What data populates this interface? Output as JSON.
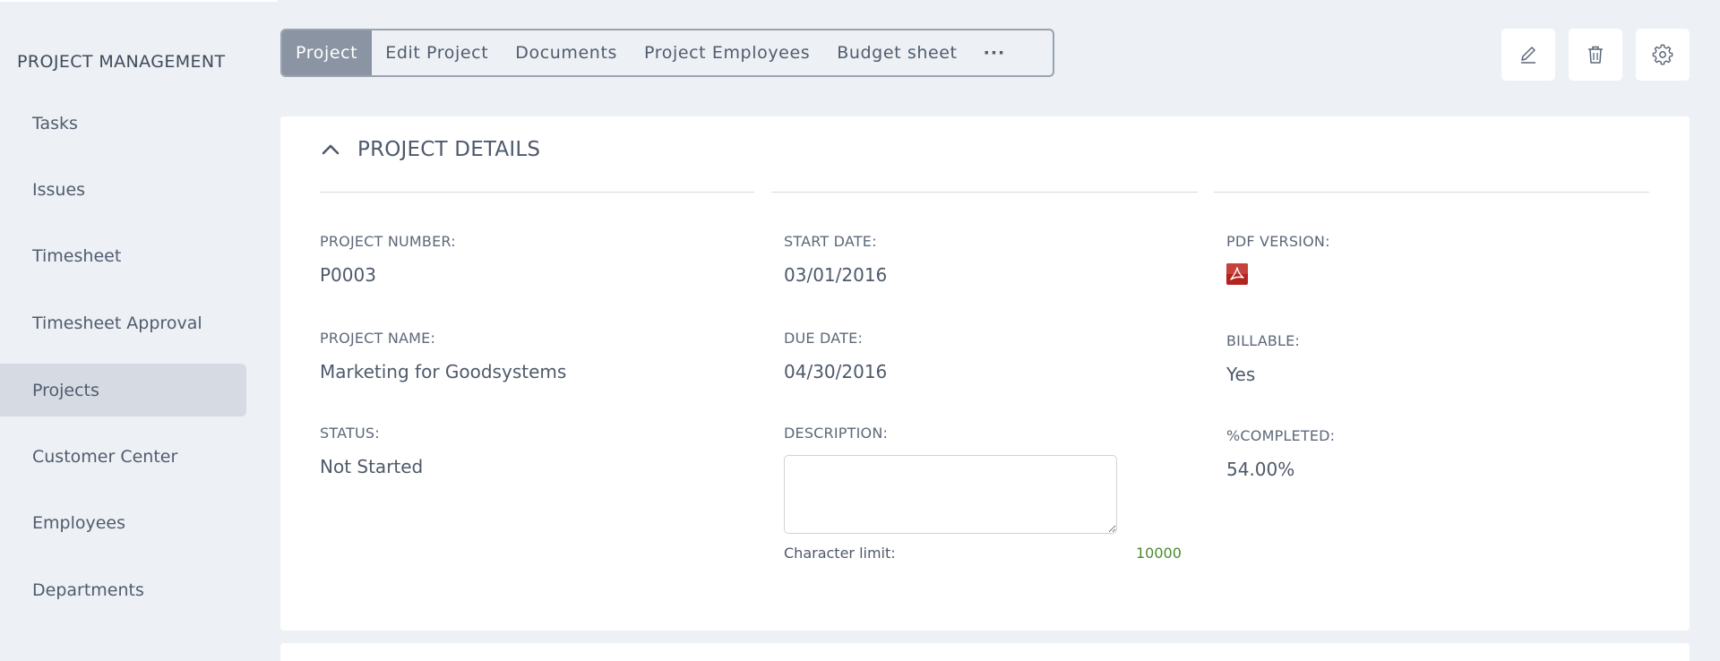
{
  "sidebar": {
    "title": "PROJECT MANAGEMENT",
    "items": [
      {
        "label": "Tasks"
      },
      {
        "label": "Issues"
      },
      {
        "label": "Timesheet"
      },
      {
        "label": "Timesheet Approval"
      },
      {
        "label": "Projects",
        "active": true
      },
      {
        "label": "Customer Center"
      },
      {
        "label": "Employees"
      },
      {
        "label": "Departments"
      }
    ]
  },
  "tabs": {
    "items": [
      {
        "label": "Project",
        "active": true
      },
      {
        "label": "Edit Project"
      },
      {
        "label": "Documents"
      },
      {
        "label": "Project Employees"
      },
      {
        "label": "Budget sheet"
      },
      {
        "label": "···"
      }
    ]
  },
  "actions": {
    "edit_icon": "pencil-icon",
    "delete_icon": "trash-icon",
    "settings_icon": "gear-icon"
  },
  "details": {
    "section_title": "PROJECT DETAILS",
    "project_number_label": "PROJECT NUMBER:",
    "project_number": "P0003",
    "project_name_label": "PROJECT NAME:",
    "project_name": "Marketing for Goodsystems",
    "status_label": "STATUS:",
    "status": "Not Started",
    "start_date_label": "START DATE:",
    "start_date": "03/01/2016",
    "due_date_label": "DUE DATE:",
    "due_date": "04/30/2016",
    "description_label": "DESCRIPTION:",
    "description": "",
    "char_limit_label": "Character limit:",
    "char_limit_value": "10000",
    "pdf_label": "PDF VERSION:",
    "pdf_icon": "pdf-file-icon",
    "billable_label": "BILLABLE:",
    "billable": "Yes",
    "completed_label": "%COMPLETED:",
    "completed": "54.00%"
  },
  "colors": {
    "background": "#edf0f4",
    "active_tab": "#8a94a3",
    "active_sidebar": "#d6dae2",
    "char_count": "#4a8a2e",
    "pdf_red": "#b3231f"
  }
}
